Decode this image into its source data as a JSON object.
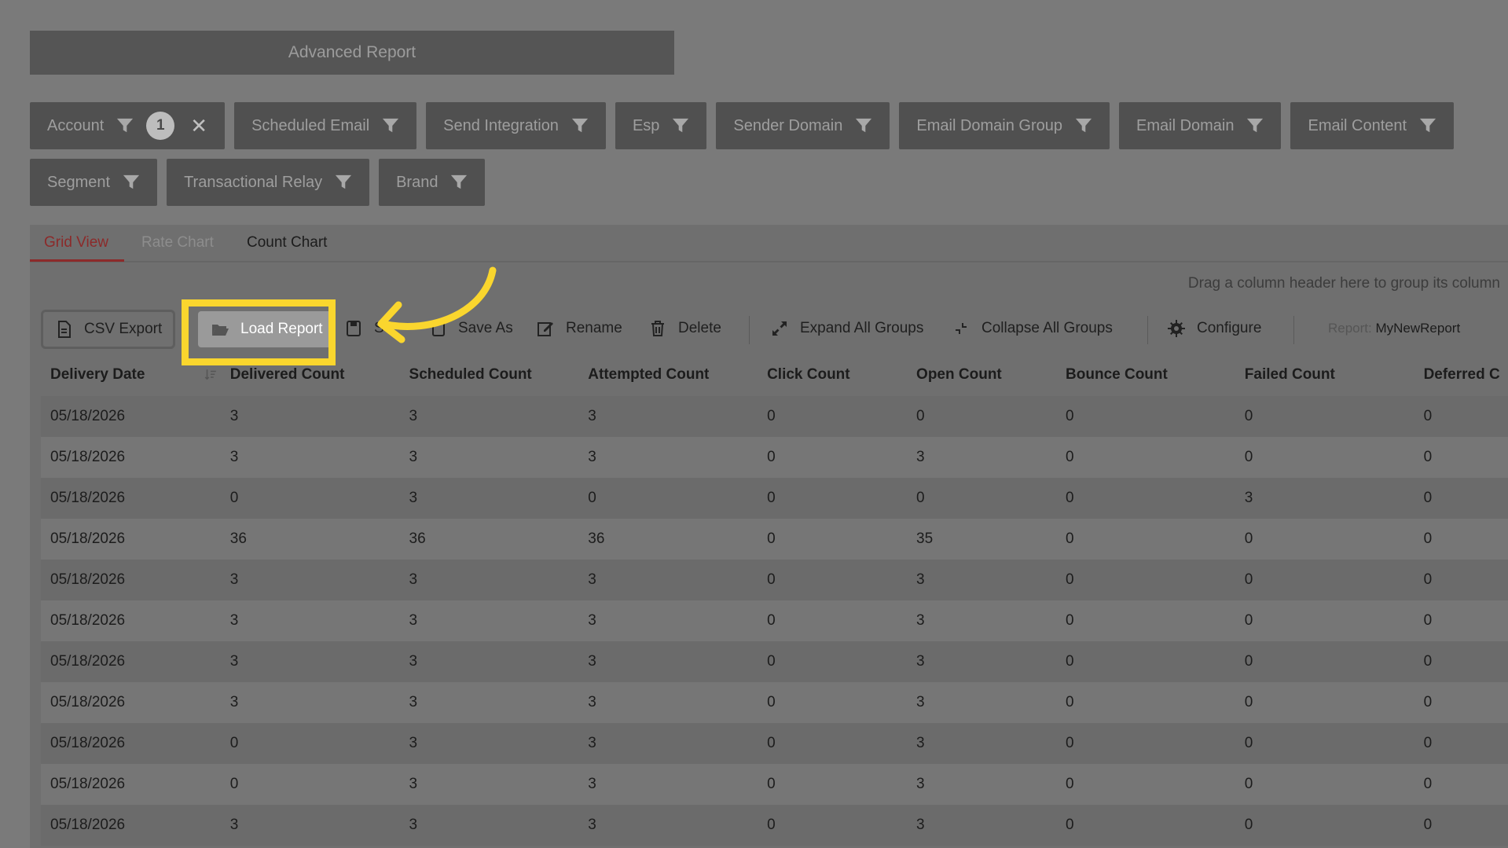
{
  "title": "Advanced Report",
  "filters": [
    {
      "label": "Account",
      "count": "1",
      "clearable": true
    },
    {
      "label": "Scheduled Email"
    },
    {
      "label": "Send Integration"
    },
    {
      "label": "Esp"
    },
    {
      "label": "Sender Domain"
    },
    {
      "label": "Email Domain Group"
    },
    {
      "label": "Email Domain"
    },
    {
      "label": "Email Content"
    },
    {
      "label": "Segment"
    },
    {
      "label": "Transactional Relay"
    },
    {
      "label": "Brand"
    }
  ],
  "filter_close_glyph": "✕",
  "tabs": {
    "grid": "Grid View",
    "rate": "Rate Chart",
    "count": "Count Chart"
  },
  "group_hint": "Drag a column header here to group its column",
  "toolbar": {
    "csv_export": "CSV Export",
    "load_report": "Load Report",
    "save": "S",
    "save_as": "Save As",
    "rename": "Rename",
    "delete": "Delete",
    "expand_all": "Expand All Groups",
    "collapse_all": "Collapse All Groups",
    "configure": "Configure",
    "report_label": "Report:",
    "report_name": "MyNewReport"
  },
  "columns": [
    "Delivery Date",
    "Delivered Count",
    "Scheduled Count",
    "Attempted Count",
    "Click Count",
    "Open Count",
    "Bounce Count",
    "Failed Count",
    "Deferred C"
  ],
  "rows": [
    [
      "05/18/2026",
      "3",
      "3",
      "3",
      "0",
      "0",
      "0",
      "0",
      "0"
    ],
    [
      "05/18/2026",
      "3",
      "3",
      "3",
      "0",
      "3",
      "0",
      "0",
      "0"
    ],
    [
      "05/18/2026",
      "0",
      "3",
      "0",
      "0",
      "0",
      "0",
      "3",
      "0"
    ],
    [
      "05/18/2026",
      "36",
      "36",
      "36",
      "0",
      "35",
      "0",
      "0",
      "0"
    ],
    [
      "05/18/2026",
      "3",
      "3",
      "3",
      "0",
      "3",
      "0",
      "0",
      "0"
    ],
    [
      "05/18/2026",
      "3",
      "3",
      "3",
      "0",
      "3",
      "0",
      "0",
      "0"
    ],
    [
      "05/18/2026",
      "3",
      "3",
      "3",
      "0",
      "3",
      "0",
      "0",
      "0"
    ],
    [
      "05/18/2026",
      "3",
      "3",
      "3",
      "0",
      "3",
      "0",
      "0",
      "0"
    ],
    [
      "05/18/2026",
      "0",
      "3",
      "3",
      "0",
      "3",
      "0",
      "0",
      "0"
    ],
    [
      "05/18/2026",
      "0",
      "3",
      "3",
      "0",
      "3",
      "0",
      "0",
      "0"
    ],
    [
      "05/18/2026",
      "3",
      "3",
      "3",
      "0",
      "3",
      "0",
      "0",
      "0"
    ]
  ],
  "colors": {
    "highlight": "#fad62e",
    "active_tab": "#8c2a2a",
    "overlay_bg": "#7a7a7a"
  }
}
